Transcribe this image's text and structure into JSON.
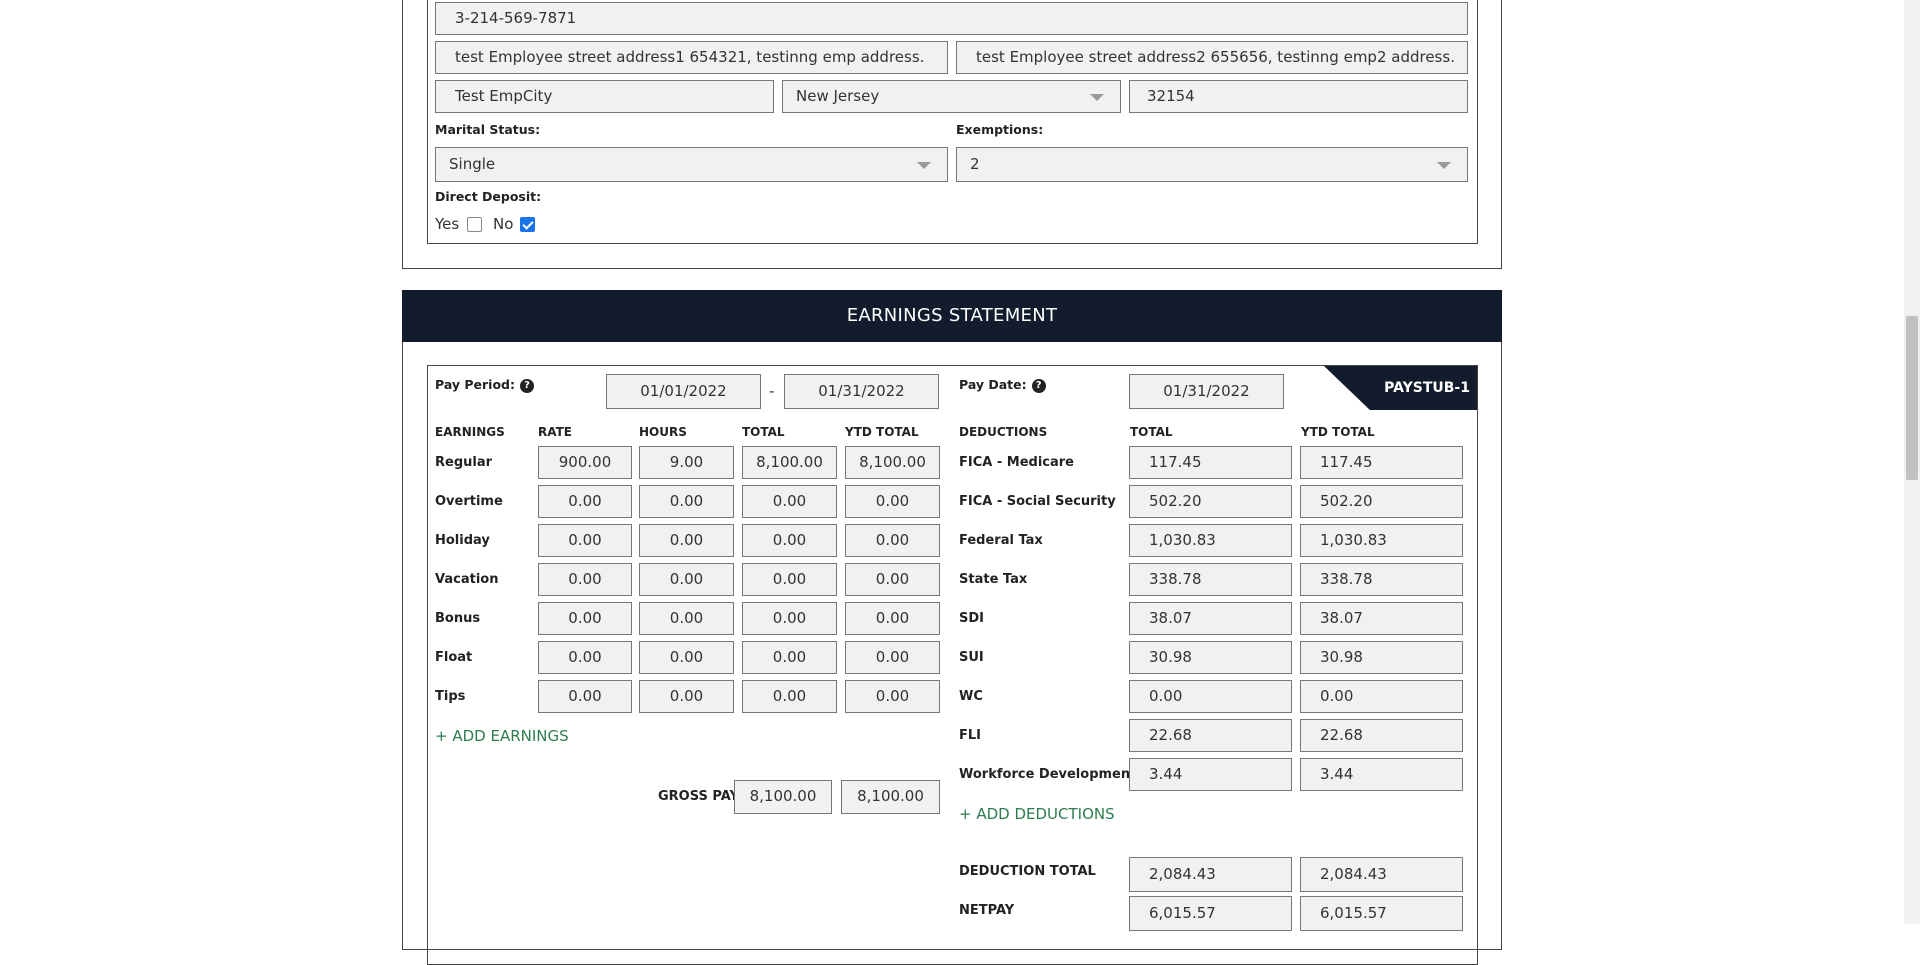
{
  "employee": {
    "phone": "3-214-569-7871",
    "address1": "test Employee street address1 654321, testinng emp address.",
    "address2": "test Employee street address2 655656, testinng emp2 address.",
    "city": "Test EmpCity",
    "state": "New Jersey",
    "zip": "32154",
    "marital_status_label": "Marital Status:",
    "marital_status": "Single",
    "exemptions_label": "Exemptions:",
    "exemptions": "2",
    "direct_deposit_label": "Direct Deposit:",
    "yes_label": "Yes",
    "no_label": "No",
    "direct_deposit_yes": false,
    "direct_deposit_no": true
  },
  "earnings_statement": {
    "title": "EARNINGS STATEMENT",
    "pay_period_label": "Pay Period:",
    "pay_period_start": "01/01/2022",
    "pay_period_dash": "-",
    "pay_period_end": "01/31/2022",
    "pay_date_label": "Pay Date:",
    "pay_date": "01/31/2022",
    "paystub_label": "PAYSTUB-1",
    "help_glyph": "?",
    "earnings_headers": [
      "EARNINGS",
      "RATE",
      "HOURS",
      "TOTAL",
      "YTD TOTAL"
    ],
    "earnings": [
      {
        "label": "Regular",
        "rate": "900.00",
        "hours": "9.00",
        "total": "8,100.00",
        "ytd": "8,100.00"
      },
      {
        "label": "Overtime",
        "rate": "0.00",
        "hours": "0.00",
        "total": "0.00",
        "ytd": "0.00"
      },
      {
        "label": "Holiday",
        "rate": "0.00",
        "hours": "0.00",
        "total": "0.00",
        "ytd": "0.00"
      },
      {
        "label": "Vacation",
        "rate": "0.00",
        "hours": "0.00",
        "total": "0.00",
        "ytd": "0.00"
      },
      {
        "label": "Bonus",
        "rate": "0.00",
        "hours": "0.00",
        "total": "0.00",
        "ytd": "0.00"
      },
      {
        "label": "Float",
        "rate": "0.00",
        "hours": "0.00",
        "total": "0.00",
        "ytd": "0.00"
      },
      {
        "label": "Tips",
        "rate": "0.00",
        "hours": "0.00",
        "total": "0.00",
        "ytd": "0.00"
      }
    ],
    "add_earnings": "+ ADD EARNINGS",
    "gross_pay_label": "GROSS PAY",
    "gross_pay_total": "8,100.00",
    "gross_pay_ytd": "8,100.00",
    "deduction_headers": [
      "DEDUCTIONS",
      "TOTAL",
      "YTD TOTAL"
    ],
    "deductions": [
      {
        "label": "FICA - Medicare",
        "total": "117.45",
        "ytd": "117.45"
      },
      {
        "label": "FICA - Social Security",
        "total": "502.20",
        "ytd": "502.20"
      },
      {
        "label": "Federal Tax",
        "total": "1,030.83",
        "ytd": "1,030.83"
      },
      {
        "label": "State Tax",
        "total": "338.78",
        "ytd": "338.78"
      },
      {
        "label": "SDI",
        "total": "38.07",
        "ytd": "38.07"
      },
      {
        "label": "SUI",
        "total": "30.98",
        "ytd": "30.98"
      },
      {
        "label": "WC",
        "total": "0.00",
        "ytd": "0.00"
      },
      {
        "label": "FLI",
        "total": "22.68",
        "ytd": "22.68"
      },
      {
        "label": "Workforce Development",
        "total": "3.44",
        "ytd": "3.44"
      }
    ],
    "add_deductions": "+ ADD DEDUCTIONS",
    "deduction_total_label": "DEDUCTION TOTAL",
    "deduction_total": "2,084.43",
    "deduction_total_ytd": "2,084.43",
    "netpay_label": "NETPAY",
    "netpay": "6,015.57",
    "netpay_ytd": "6,015.57"
  }
}
